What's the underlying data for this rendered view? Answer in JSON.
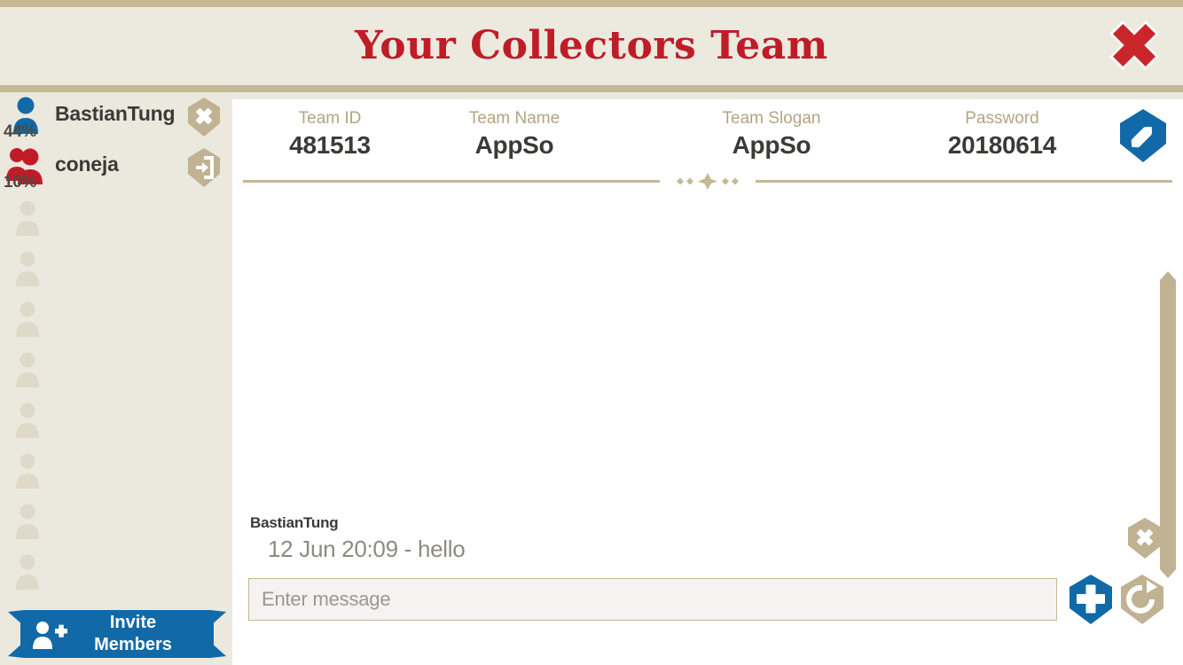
{
  "header": {
    "title": "Your Collectors Team",
    "close_icon": "close-x-icon"
  },
  "colors": {
    "accent_red": "#c01c28",
    "accent_blue": "#1269a8",
    "tan": "#c6b894",
    "cream": "#eceadf",
    "panel": "#ffffff",
    "text_dark": "#3b3a36",
    "label_tan": "#b3a581"
  },
  "sidebar": {
    "members": [
      {
        "name": "BastianTung",
        "percent": "44%",
        "avatar_icon": "single-person-icon",
        "avatar_color": "#1269a8",
        "action_icon": "remove-member-x-icon"
      },
      {
        "name": "coneja",
        "percent": "10%",
        "avatar_icon": "double-person-icon",
        "avatar_color": "#c01c28",
        "action_icon": "leave-team-door-icon"
      }
    ],
    "empty_slot_count": 8,
    "empty_slot_icon": "empty-person-placeholder-icon",
    "invite": {
      "line1": "Invite",
      "line2": "Members",
      "icon": "add-person-icon"
    }
  },
  "team_info": {
    "fields": [
      {
        "label": "Team ID",
        "value": "481513"
      },
      {
        "label": "Team Name",
        "value": "AppSo"
      },
      {
        "label": "Team Slogan",
        "value": "AppSo"
      },
      {
        "label": "Password",
        "value": "20180614"
      }
    ],
    "edit_icon": "pencil-edit-icon"
  },
  "divider": {
    "ornament_icon": "four-point-star-ornament"
  },
  "chat": {
    "messages": [
      {
        "author": "BastianTung",
        "text": "12 Jun 20:09 - hello"
      }
    ],
    "clear_icon": "clear-messages-x-icon",
    "scrollbar_icon": "vertical-scrollbar"
  },
  "composer": {
    "placeholder": "Enter message",
    "value": "",
    "send_icon": "plus-send-icon",
    "refresh_icon": "refresh-reload-icon"
  }
}
